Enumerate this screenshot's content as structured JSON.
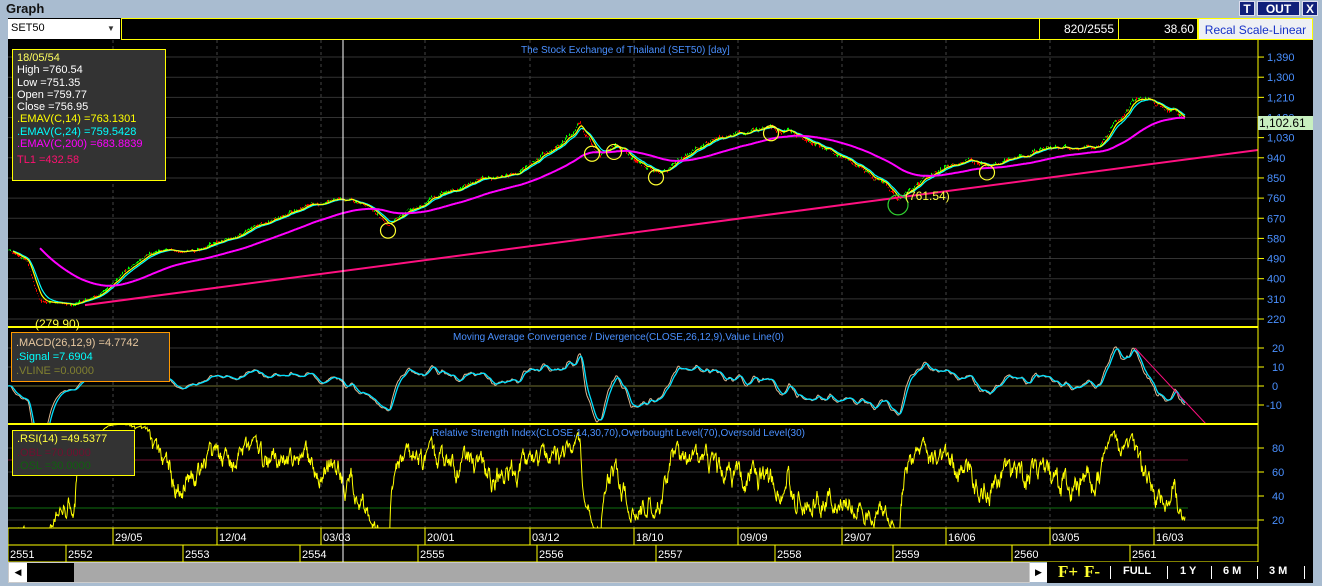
{
  "window": {
    "title": "Graph",
    "buttons": [
      "T",
      "OUT",
      "X"
    ]
  },
  "toolbar": {
    "symbol": "SET50",
    "position": "820/2555",
    "value": "38.60",
    "recal": "Recal Scale-Linear"
  },
  "price_panel": {
    "title": "The Stock Exchange of Thailand (SET50) [day]",
    "legend": {
      "date": "18/05/54",
      "high": "High  =760.54",
      "low": "Low  =751.35",
      "open": "Open  =759.77",
      "close": "Close  =756.95",
      "ema14": ".EMAV(C,14)   =763.1301",
      "ema24": ".EMAV(C,24)   =759.5428",
      "ema200": ".EMAV(C,200)   =683.8839",
      "tl1": "TL1 =432.58"
    },
    "last_price": "1,102.61",
    "annotations": {
      "low": "(279.90)",
      "swing_low": "(761.54)"
    },
    "colors": {
      "ema14": "#ffff00",
      "ema24": "#00ffff",
      "ema200": "#ff00ff",
      "tl1": "#ff1080",
      "up": "#00ff00",
      "down": "#ff0000"
    }
  },
  "macd_panel": {
    "title": "Moving Average Convergence / Divergence(CLOSE,26,12,9),Value Line(0)",
    "legend": {
      "macd": ".MACD(26,12,9)    =4.7742",
      "signal": ".Signal   =7.6904",
      "vline": ".VLINE   =0.0000"
    }
  },
  "rsi_panel": {
    "title": "Relative Strength Index(CLOSE,14,30,70),Overbought Level(70),Oversold Level(30)",
    "legend": {
      "rsi": ".RSI(14)    =49.5377",
      "obl": ".OBL    =70.0000",
      "osl": ".OSL    =30.0000"
    }
  },
  "footer": {
    "zoom_in": "F+",
    "zoom_out": "F-",
    "ranges": [
      "FULL",
      "1 Y",
      "6 M",
      "3 M"
    ]
  },
  "chart_data": [
    {
      "type": "line",
      "title": "The Stock Exchange of Thailand (SET50) [day]",
      "ylim": [
        220,
        1390
      ],
      "yticks": [
        1390,
        1300,
        1210,
        1120,
        1030,
        940,
        850,
        760,
        670,
        580,
        490,
        400,
        310,
        220
      ],
      "ytick_labels": [
        "1,390",
        "1,300",
        "1,210",
        "1,120",
        "1,030",
        "940",
        "850",
        "760",
        "670",
        "580",
        "490",
        "400",
        "310",
        "220"
      ],
      "x_date_labels": [
        "29/05",
        "12/04",
        "03/03",
        "20/01",
        "03/12",
        "18/10",
        "09/09",
        "29/07",
        "16/06",
        "03/05",
        "16/03"
      ],
      "x_year_labels": [
        "2551",
        "2552",
        "2553",
        "2554",
        "2555",
        "2556",
        "2557",
        "2558",
        "2559",
        "2560",
        "2561"
      ],
      "close_keypoints": [
        [
          0,
          530
        ],
        [
          40,
          470
        ],
        [
          64,
          300
        ],
        [
          110,
          285
        ],
        [
          134,
          279.9
        ],
        [
          184,
          330
        ],
        [
          240,
          450
        ],
        [
          284,
          520
        ],
        [
          384,
          530
        ],
        [
          484,
          620
        ],
        [
          584,
          720
        ],
        [
          664,
          770
        ],
        [
          704,
          740
        ],
        [
          760,
          645
        ],
        [
          824,
          730
        ],
        [
          924,
          830
        ],
        [
          1024,
          880
        ],
        [
          1104,
          1000
        ],
        [
          1144,
          1090
        ],
        [
          1184,
          960
        ],
        [
          1224,
          990
        ],
        [
          1264,
          920
        ],
        [
          1304,
          870
        ],
        [
          1384,
          990
        ],
        [
          1464,
          1050
        ],
        [
          1524,
          1080
        ],
        [
          1584,
          1050
        ],
        [
          1684,
          930
        ],
        [
          1764,
          800
        ],
        [
          1780,
          761.54
        ],
        [
          1864,
          890
        ],
        [
          1924,
          940
        ],
        [
          1964,
          910
        ],
        [
          2004,
          930
        ],
        [
          2084,
          970
        ],
        [
          2184,
          1000
        ],
        [
          2244,
          1180
        ],
        [
          2284,
          1200
        ],
        [
          2330,
          1170
        ],
        [
          2354,
          1102.61
        ]
      ],
      "trendline_TL1": [
        [
          154,
          282
        ],
        [
          2500,
          975
        ]
      ],
      "markers": [
        760,
        1168,
        1212,
        1296,
        1526,
        1780,
        1958
      ]
    },
    {
      "type": "line",
      "title": "MACD",
      "ylim": [
        -20,
        25
      ],
      "yticks": [
        20,
        10,
        0,
        -10
      ]
    },
    {
      "type": "line",
      "title": "RSI",
      "ylim": [
        10,
        95
      ],
      "yticks": [
        80,
        60,
        40,
        20
      ],
      "levels": [
        70,
        30
      ]
    }
  ]
}
